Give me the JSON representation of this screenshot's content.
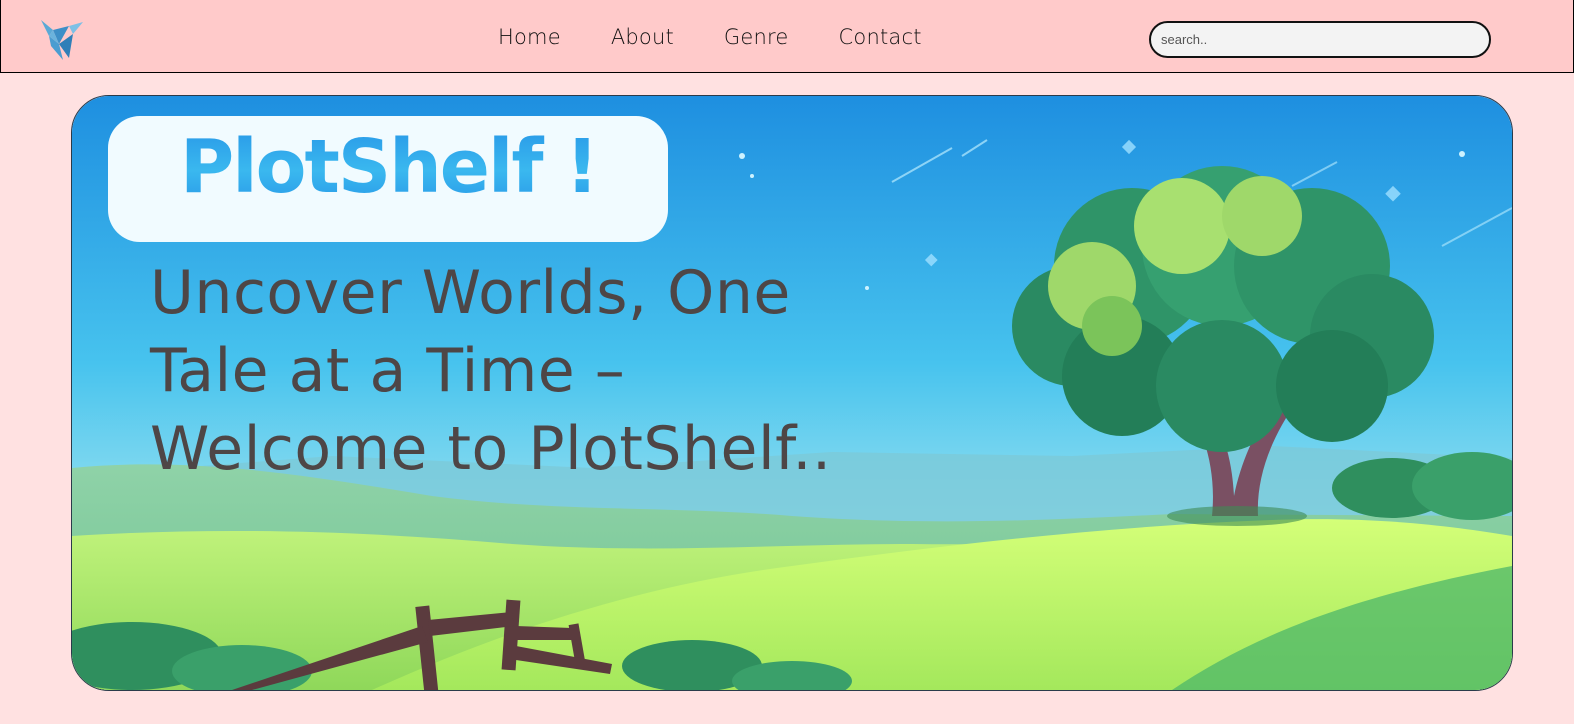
{
  "nav": {
    "logo_icon": "bird-icon",
    "links": [
      {
        "label": "Home"
      },
      {
        "label": "About"
      },
      {
        "label": "Genre"
      },
      {
        "label": "Contact"
      }
    ],
    "search": {
      "placeholder": "search..",
      "value": ""
    }
  },
  "hero": {
    "brand": "PlotShelf !",
    "tagline": "Uncover Worlds, One Tale at a Time – Welcome to PlotShelf..",
    "background": "cartoon-landscape-tree-hills"
  },
  "colors": {
    "nav_bg": "#ffcaca",
    "page_bg": "#ffe1e1",
    "brand_blue": "#2a9be8",
    "tagline_text": "#4e4646"
  }
}
